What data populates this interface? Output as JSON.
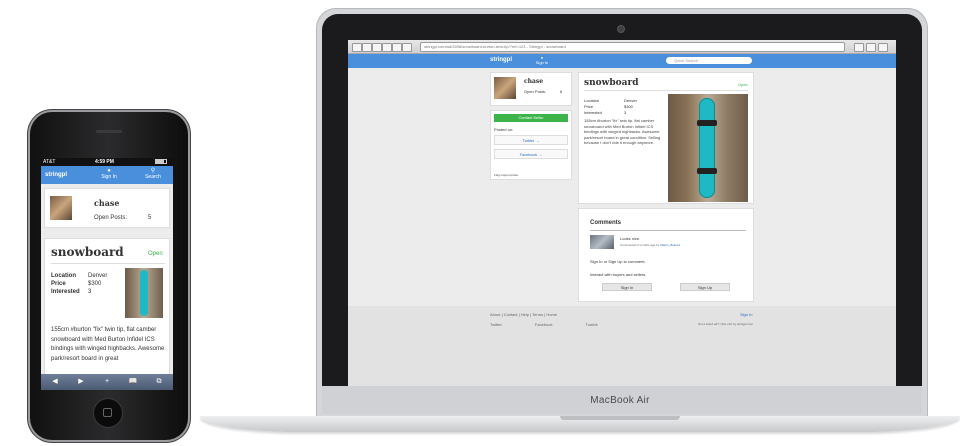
{
  "laptop": {
    "brand_label": "MacBook Air",
    "browser": {
      "url": "stringpl.com/ad/3498/snowboard-burton-twin-tip/?ref=123 - Stringpl - snowboard"
    },
    "site": {
      "logo": "stringpl",
      "nav_signin": "Sign In",
      "search_placeholder": "Quick Search",
      "seller": {
        "name": "chase",
        "open_posts_label": "Open Posts:",
        "open_posts": "6"
      },
      "share": {
        "contact_button": "Contact Seller",
        "posted_on": "Posted on:",
        "twitter": "Twitter →",
        "facebook": "Facebook →",
        "flag": "Flag inappropriate"
      },
      "listing": {
        "title": "snowboard",
        "status": "Open",
        "labels": [
          "Location",
          "Price",
          "Interested"
        ],
        "values": [
          "Denver",
          "$300",
          "3"
        ],
        "description": "155cm #burton \"fix\" twin tip, flat camber snowboard with Med Burton Infidel ICS bindings with winged highbacks. Awesome park/resort board in great condition. Selling because I don't ride it enough anymore."
      },
      "comments": {
        "title": "Comments",
        "comment_text": "Looks nice.",
        "comment_meta": "Commented 3 months ago by",
        "comment_author": "Martin_Bekes1",
        "prompt": "Sign In or Sign Up to comment.",
        "interact": "Interact with buyers and sellers.",
        "signin_button": "Sign In",
        "signup_button": "Sign Up"
      },
      "footer": {
        "links": "About | Contact | Help | Terms | Home",
        "signin": "Sign In",
        "twitter": "Twitter",
        "facebook": "Facebook",
        "tumblr": "Tumblr",
        "right": "Not a listed ad?  |  Site info by stringpl.com"
      }
    }
  },
  "phone": {
    "status": {
      "carrier": "AT&T",
      "time": "4:59 PM"
    },
    "logo": "stringpl",
    "nav": {
      "signin": "Sign In",
      "search": "Search"
    },
    "seller": {
      "name": "chase",
      "open_posts_label": "Open Posts:",
      "open_posts": "5"
    },
    "listing": {
      "title": "snowboard",
      "status": "Open",
      "labels": [
        "Location",
        "Price",
        "Interested"
      ],
      "values": [
        "Denver",
        "$300",
        "3"
      ],
      "description": "155cm #burton \"fix\" twin tip, flat camber snowboard with Med Burton Infidel ICS bindings with winged highbacks. Awesome park/resort board in great"
    },
    "toolbar": [
      "◀",
      "▶",
      "+",
      "📖",
      "⧉"
    ]
  },
  "colors": {
    "brand_blue": "#4a8fdb",
    "open_green": "#3cb449",
    "board_teal": "#1fb9c6"
  }
}
